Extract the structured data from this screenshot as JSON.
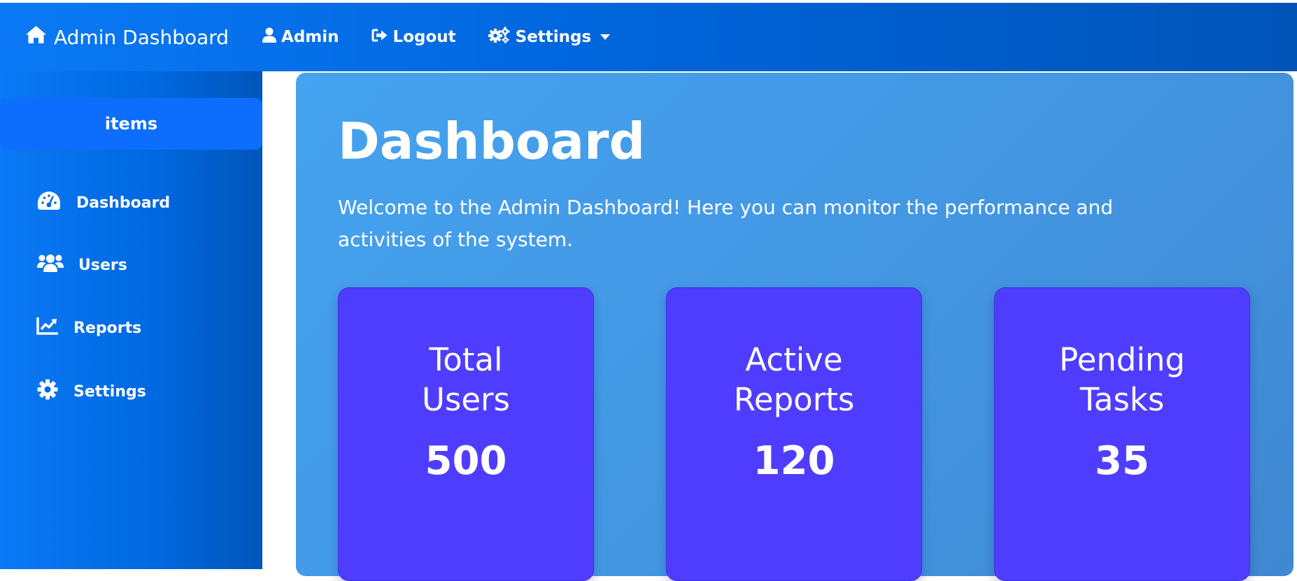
{
  "navbar": {
    "brand_icon": "home-icon",
    "brand_label": "Admin Dashboard",
    "items": [
      {
        "icon": "user-icon",
        "label": "Admin"
      },
      {
        "icon": "logout-icon",
        "label": "Logout"
      },
      {
        "icon": "gears-icon",
        "label": "Settings",
        "dropdown": true
      }
    ]
  },
  "sidebar": {
    "header": "items",
    "items": [
      {
        "icon": "dashboard-gauge-icon",
        "label": "Dashboard"
      },
      {
        "icon": "users-icon",
        "label": "Users"
      },
      {
        "icon": "chart-line-icon",
        "label": "Reports"
      },
      {
        "icon": "gear-icon",
        "label": "Settings"
      }
    ]
  },
  "main": {
    "title": "Dashboard",
    "welcome": "Welcome to the Admin Dashboard! Here you can monitor the performance and activities of the system.",
    "stats": [
      {
        "label": "Total Users",
        "value": "500"
      },
      {
        "label": "Active Reports",
        "value": "120"
      },
      {
        "label": "Pending Tasks",
        "value": "35"
      }
    ]
  },
  "colors": {
    "navbar": "#0066dd",
    "sidebar": "#0068e0",
    "sidebar_header": "#0d6efd",
    "main_panel": "#4396e2",
    "stat_card": "#4f3dff",
    "text": "#ffffff"
  }
}
